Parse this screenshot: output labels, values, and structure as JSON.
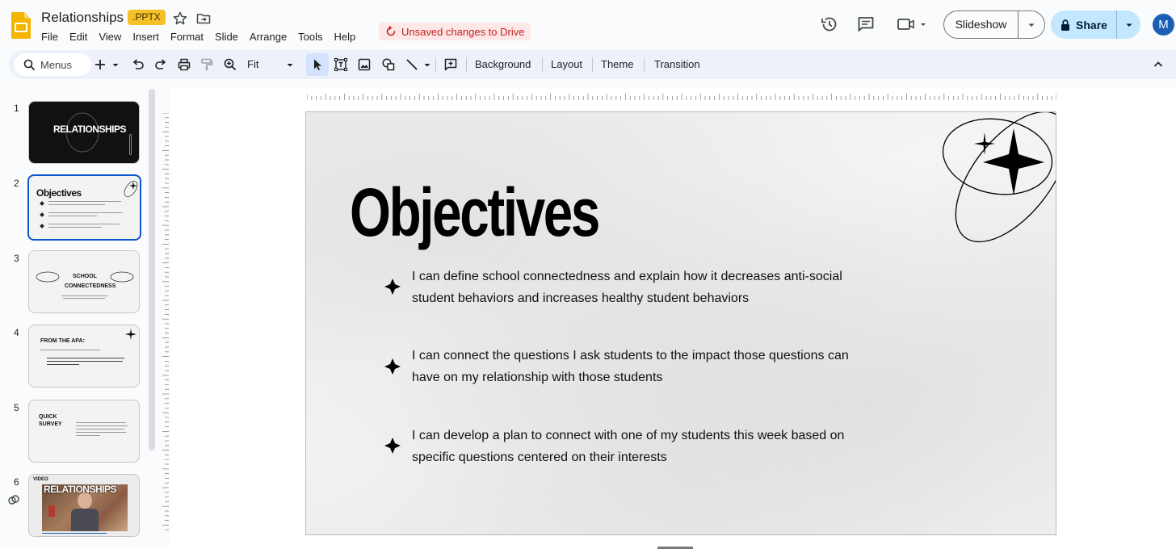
{
  "app": {
    "title": "Relationships",
    "file_badge": ".PPTX",
    "unsaved_text": "Unsaved changes to Drive",
    "menus": [
      "File",
      "Edit",
      "View",
      "Insert",
      "Format",
      "Slide",
      "Arrange",
      "Tools",
      "Help"
    ],
    "slideshow_label": "Slideshow",
    "share_label": "Share",
    "avatar_initial": "M"
  },
  "toolbar": {
    "search_label": "Menus",
    "zoom_label": "Fit",
    "background_label": "Background",
    "layout_label": "Layout",
    "theme_label": "Theme",
    "transition_label": "Transition"
  },
  "filmstrip": {
    "slides": [
      {
        "num": "1",
        "title": "RELATIONSHIPS"
      },
      {
        "num": "2",
        "title": "Objectives"
      },
      {
        "num": "3",
        "title": "SCHOOL CONNECTEDNESS"
      },
      {
        "num": "4",
        "title": "FROM THE APA:"
      },
      {
        "num": "5",
        "title": "QUICK SURVEY"
      },
      {
        "num": "6",
        "label": "VIDEO",
        "title": "RELATIONSHIPS"
      }
    ]
  },
  "slide": {
    "title": "Objectives",
    "bullets": [
      {
        "line1": "I can define school connectedness and explain how it decreases anti-social",
        "line2": "student behaviors and increases healthy student behaviors"
      },
      {
        "line1": "I can connect the questions I ask students to the impact those questions can",
        "line2": "have on my relationship with those students"
      },
      {
        "line1": "I can develop a plan to connect with one of my students this week based on",
        "line2": "specific questions centered on their interests"
      }
    ]
  },
  "colors": {
    "accent": "#0b57d0",
    "share_bg": "#c2e7ff",
    "badge": "#f6c026",
    "unsaved_bg": "#fde7e7",
    "unsaved_text": "#c5221f",
    "toolbar_bg": "#edf2fa"
  }
}
